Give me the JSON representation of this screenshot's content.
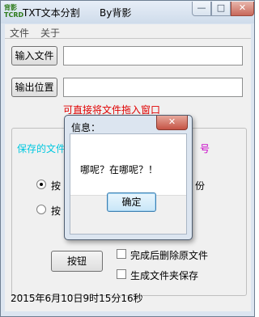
{
  "window": {
    "title": "TXT文本分割",
    "subtitle": "By背影",
    "icon_text": "背影TCRD",
    "controls": {
      "minimize": "—",
      "maximize": "□",
      "close": "✕"
    }
  },
  "menu": [
    "文件",
    "关于"
  ],
  "input_file": {
    "button": "输入文件",
    "value": ""
  },
  "output_location": {
    "button": "输出位置",
    "value": ""
  },
  "drag_hint": "可直接将文件拖入窗口",
  "group": {
    "caption_left": "保存的文件",
    "caption_right": "号",
    "radio1_label": "按",
    "radio1_right": "份",
    "radio2_label": "按",
    "action_button": "按钮",
    "checkbox1_label": "完成后删除原文件",
    "checkbox2_label": "生成文件夹保存"
  },
  "status": "2015年6月10日9时15分16秒",
  "dialog": {
    "title": "信息：",
    "close": "✕",
    "message": "哪呢？在哪呢？！",
    "ok_button": "确定"
  },
  "colors": {
    "hint_red": "#e00000",
    "caption_cyan": "#00c8e0",
    "caption_magenta": "#c800c8"
  }
}
